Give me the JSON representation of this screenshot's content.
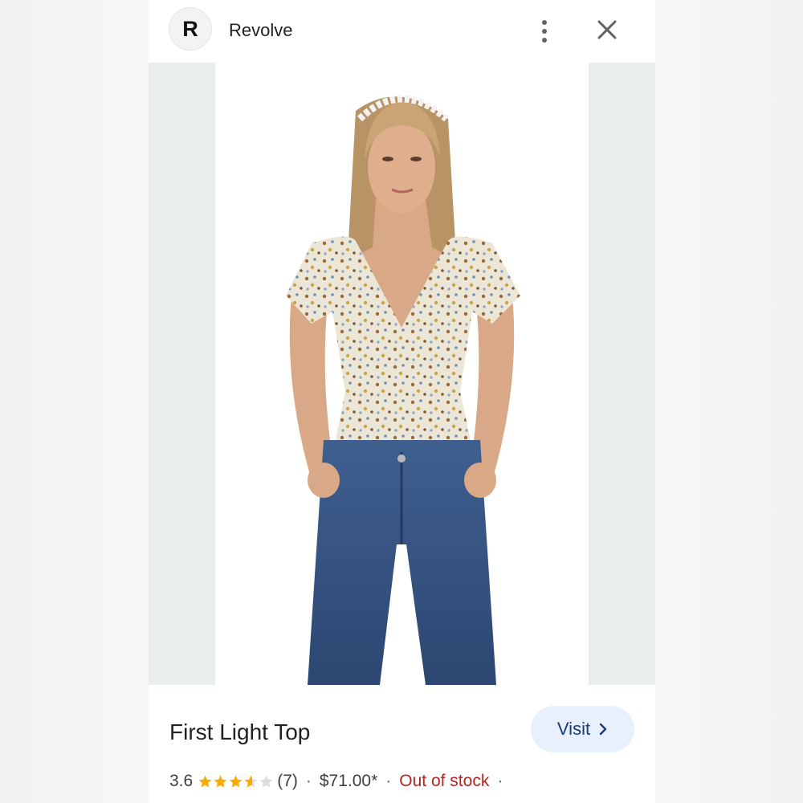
{
  "header": {
    "avatar_letter": "R",
    "source_name": "Revolve",
    "more_icon": "more-vert-icon",
    "close_icon": "close-icon"
  },
  "product": {
    "title": "First Light Top",
    "visit_label": "Visit",
    "rating": "3.6",
    "rating_value": 3.6,
    "rating_max": 5,
    "review_count": "(7)",
    "price": "$71.00*",
    "stock_status": "Out of stock",
    "separator": "·"
  },
  "colors": {
    "star_filled": "#f9ab00",
    "star_empty": "#dadce0",
    "stock_status": "#b3261e",
    "visit_bg": "#e8f0fe"
  }
}
